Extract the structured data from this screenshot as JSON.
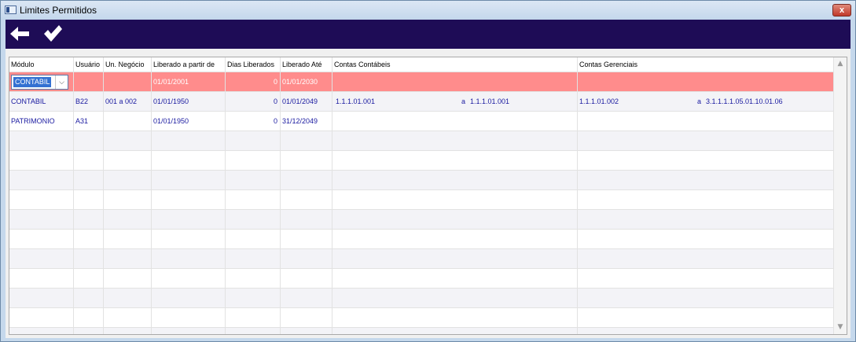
{
  "window": {
    "title": "Limites Permitidos",
    "close_label": "x"
  },
  "grid": {
    "headers": [
      "Módulo",
      "Usuário",
      "Un. Negócio",
      "Liberado a partir de",
      "Dias Liberados",
      "Liberado Até",
      "Contas Contábeis",
      "Contas Gerenciais"
    ],
    "rows": [
      {
        "modulo": "CONTABIL",
        "usuario": "",
        "un_negocio": "",
        "liberado_de": "01/01/2001",
        "dias": "0",
        "liberado_ate": "01/01/2030",
        "contabeis_de": "",
        "contabeis_a": "",
        "contabeis_ate": "",
        "gerenciais_de": "",
        "gerenciais_a": "",
        "gerenciais_ate": ""
      },
      {
        "modulo": "CONTABIL",
        "usuario": "B22",
        "un_negocio": "001  a  002",
        "liberado_de": "01/01/1950",
        "dias": "0",
        "liberado_ate": "01/01/2049",
        "contabeis_de": "1.1.1.01.001",
        "contabeis_a": "a",
        "contabeis_ate": "1.1.1.01.001",
        "gerenciais_de": "1.1.1.01.002",
        "gerenciais_a": "a",
        "gerenciais_ate": "3.1.1.1.1.05.01.10.01.06"
      },
      {
        "modulo": "PATRIMONIO",
        "usuario": "A31",
        "un_negocio": "",
        "liberado_de": "01/01/1950",
        "dias": "0",
        "liberado_ate": "31/12/2049",
        "contabeis_de": "",
        "contabeis_a": "",
        "contabeis_ate": "",
        "gerenciais_de": "",
        "gerenciais_a": "",
        "gerenciais_ate": ""
      }
    ]
  },
  "icons": {
    "back": "arrow-left-icon",
    "confirm": "checkmark-icon",
    "dropdown": "chevron-down-icon",
    "scroll_up": "chevron-up-icon",
    "scroll_down": "chevron-down-icon"
  },
  "colors": {
    "toolbar": "#1e0c56",
    "selected_row": "#ff8c8c",
    "cell_text": "#1a1aa0",
    "combo_highlight": "#3371d2"
  }
}
